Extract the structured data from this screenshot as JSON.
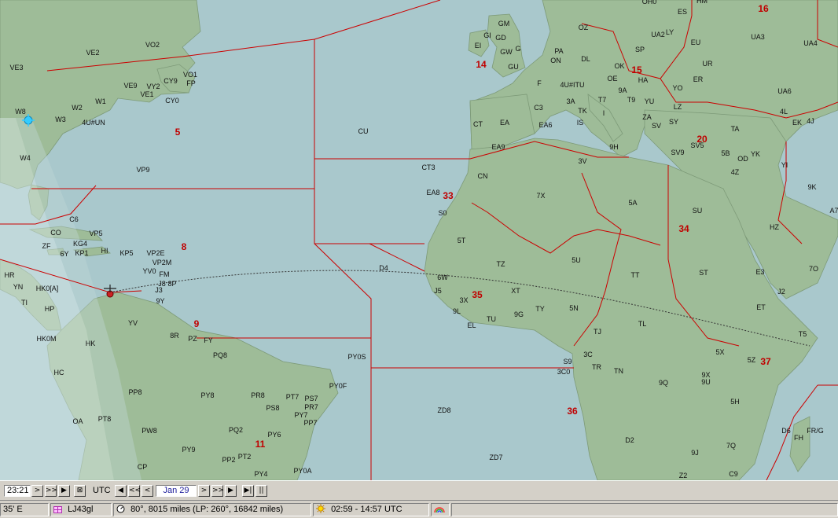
{
  "map": {
    "zones": [
      "5",
      "8",
      "9",
      "11",
      "14",
      "15",
      "16",
      "20",
      "33",
      "34",
      "35",
      "36",
      "37"
    ],
    "prefixes": {
      "west": [
        "VE2",
        "VO2",
        "VE3",
        "VE9",
        "VY2",
        "VE1",
        "CY9",
        "VO1",
        "FP",
        "CY0",
        "W1",
        "W2",
        "W3",
        "4U#UN",
        "W8",
        "W4",
        "VP9",
        "C6",
        "CO",
        "VP5",
        "ZF",
        "KG4",
        "KP1",
        "HI",
        "6Y",
        "KP5",
        "VP2E",
        "VP2M",
        "YV0",
        "FM",
        "J8",
        "8P",
        "J3",
        "9Y",
        "HR",
        "YN",
        "HK0[A]",
        "TI",
        "HP",
        "HK0M",
        "YV",
        "8R",
        "PZ",
        "FY",
        "HK",
        "PY0S",
        "PY0F",
        "HC",
        "PP8",
        "PQ8",
        "PY8",
        "PR8",
        "PT7",
        "PS7",
        "PR7",
        "PY7",
        "PP7",
        "PS8",
        "OA",
        "PT8",
        "PW8",
        "PQ2",
        "PY6",
        "PY9",
        "PP2",
        "PT2",
        "CP",
        "PY4",
        "PY0A",
        "ZD8",
        "ZD7",
        "CU",
        "CT3",
        "EA8",
        "S0",
        "5T",
        "D4",
        "6W",
        "J5",
        "3X",
        "9L",
        "EL",
        "TU",
        "9G",
        "TY",
        "XT",
        "5N",
        "TJ",
        "S9",
        "3C0",
        "3C",
        "TR",
        "TN",
        "9Q",
        "D2",
        "9J"
      ],
      "east": [
        "GM",
        "GI",
        "GD",
        "EI",
        "GW",
        "G",
        "GU",
        "OZ",
        "SP",
        "PA",
        "ON",
        "DL",
        "F",
        "4U#ITU",
        "OK",
        "OE",
        "HA",
        "3A",
        "9A",
        "T9",
        "YU",
        "T7",
        "I",
        "ZA",
        "SV",
        "SY",
        "LZ",
        "YO",
        "ER",
        "UR",
        "EU",
        "UA2",
        "LY",
        "ES",
        "OH0",
        "HM",
        "UA3",
        "UA4",
        "UA6",
        "4L",
        "EK",
        "4J",
        "TA",
        "SV5",
        "SV9",
        "5B",
        "OD",
        "YK",
        "4Z",
        "YI",
        "9K",
        "A7",
        "HZ",
        "C3",
        "CT",
        "EA",
        "EA6",
        "EA9",
        "TK",
        "IS",
        "9H",
        "3V",
        "CN",
        "7X",
        "5A",
        "SU",
        "ST",
        "E3",
        "J2",
        "ET",
        "T5",
        "7O",
        "5X",
        "5Z",
        "9X",
        "9U",
        "5H",
        "7Q",
        "C9",
        "Z2",
        "D6",
        "FH",
        "FR/G",
        "TT",
        "TL",
        "5U",
        "TZ"
      ]
    }
  },
  "controls": {
    "time": "23:21",
    "time_label": "UTC",
    "date": "Jan 29",
    "buttons": {
      "next": ">",
      "fast_fwd": ">>",
      "step": "▶",
      "mark": "⊠",
      "back_far": "◀",
      "back_fast": "<<",
      "back": "<",
      "date_next": ">",
      "date_fast": ">>",
      "date_step": "▶",
      "play": "▶|",
      "pause": "||"
    }
  },
  "status": {
    "longitude": "35' E",
    "locator": "LJ43gl",
    "bearing": "80°, 8015 miles  (LP: 260°, 16842 miles)",
    "sun": "02:59 - 14:57 UTC"
  },
  "colors": {
    "ocean": "#a9c8cc",
    "land": "#9ebc98",
    "night": "#c8dcda",
    "border": "#cc0000",
    "zone_label": "#c00000",
    "path": "#333333",
    "marker_station": "#33ccff",
    "marker_home": "#cc2222"
  }
}
